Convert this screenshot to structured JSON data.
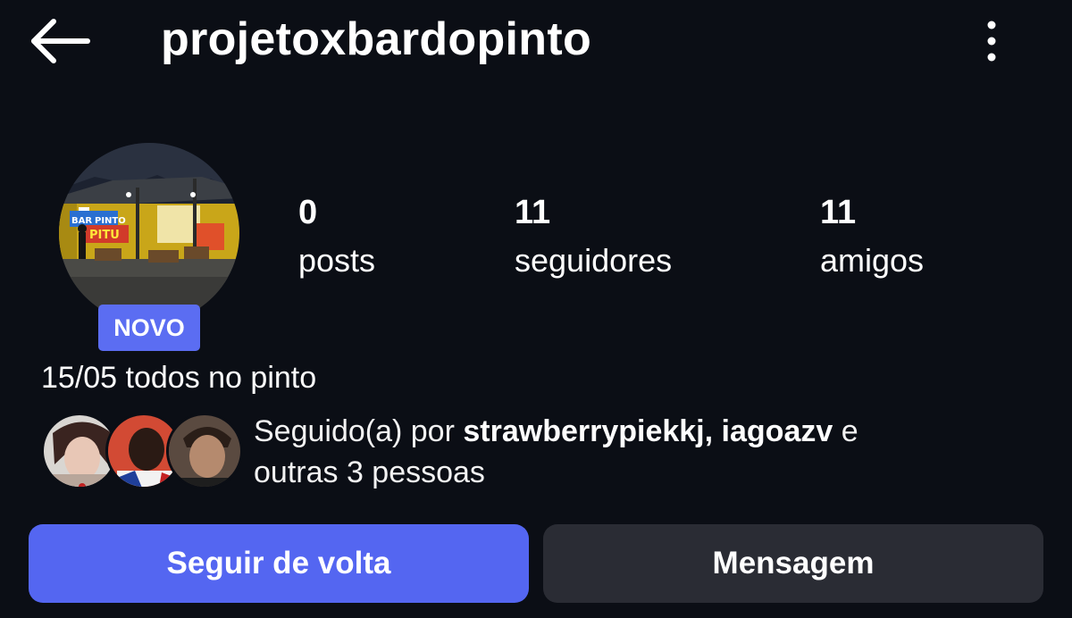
{
  "header": {
    "username": "projetoxbardopinto",
    "back_icon": "arrow-left-icon",
    "menu_icon": "more-vertical-icon"
  },
  "profile": {
    "badge": "NOVO",
    "avatar_sign_text": [
      "BAR",
      "PINTO",
      "PITU"
    ],
    "stats": [
      {
        "value": "0",
        "label": "posts"
      },
      {
        "value": "11",
        "label": "seguidores"
      },
      {
        "value": "11",
        "label": "amigos"
      }
    ],
    "bio": "15/05 todos no pinto"
  },
  "followed_by": {
    "prefix": "Seguido(a) por ",
    "user1": "strawberrypiekkj",
    "sep": ", ",
    "user2": "iagoazv",
    "conj": " e",
    "rest": "outras 3 pessoas"
  },
  "actions": {
    "follow_back": "Seguir de volta",
    "message": "Mensagem"
  },
  "colors": {
    "background": "#0b0e15",
    "accent": "#5466f1",
    "badge": "#5b6df2",
    "secondary_button": "#2a2c34"
  }
}
